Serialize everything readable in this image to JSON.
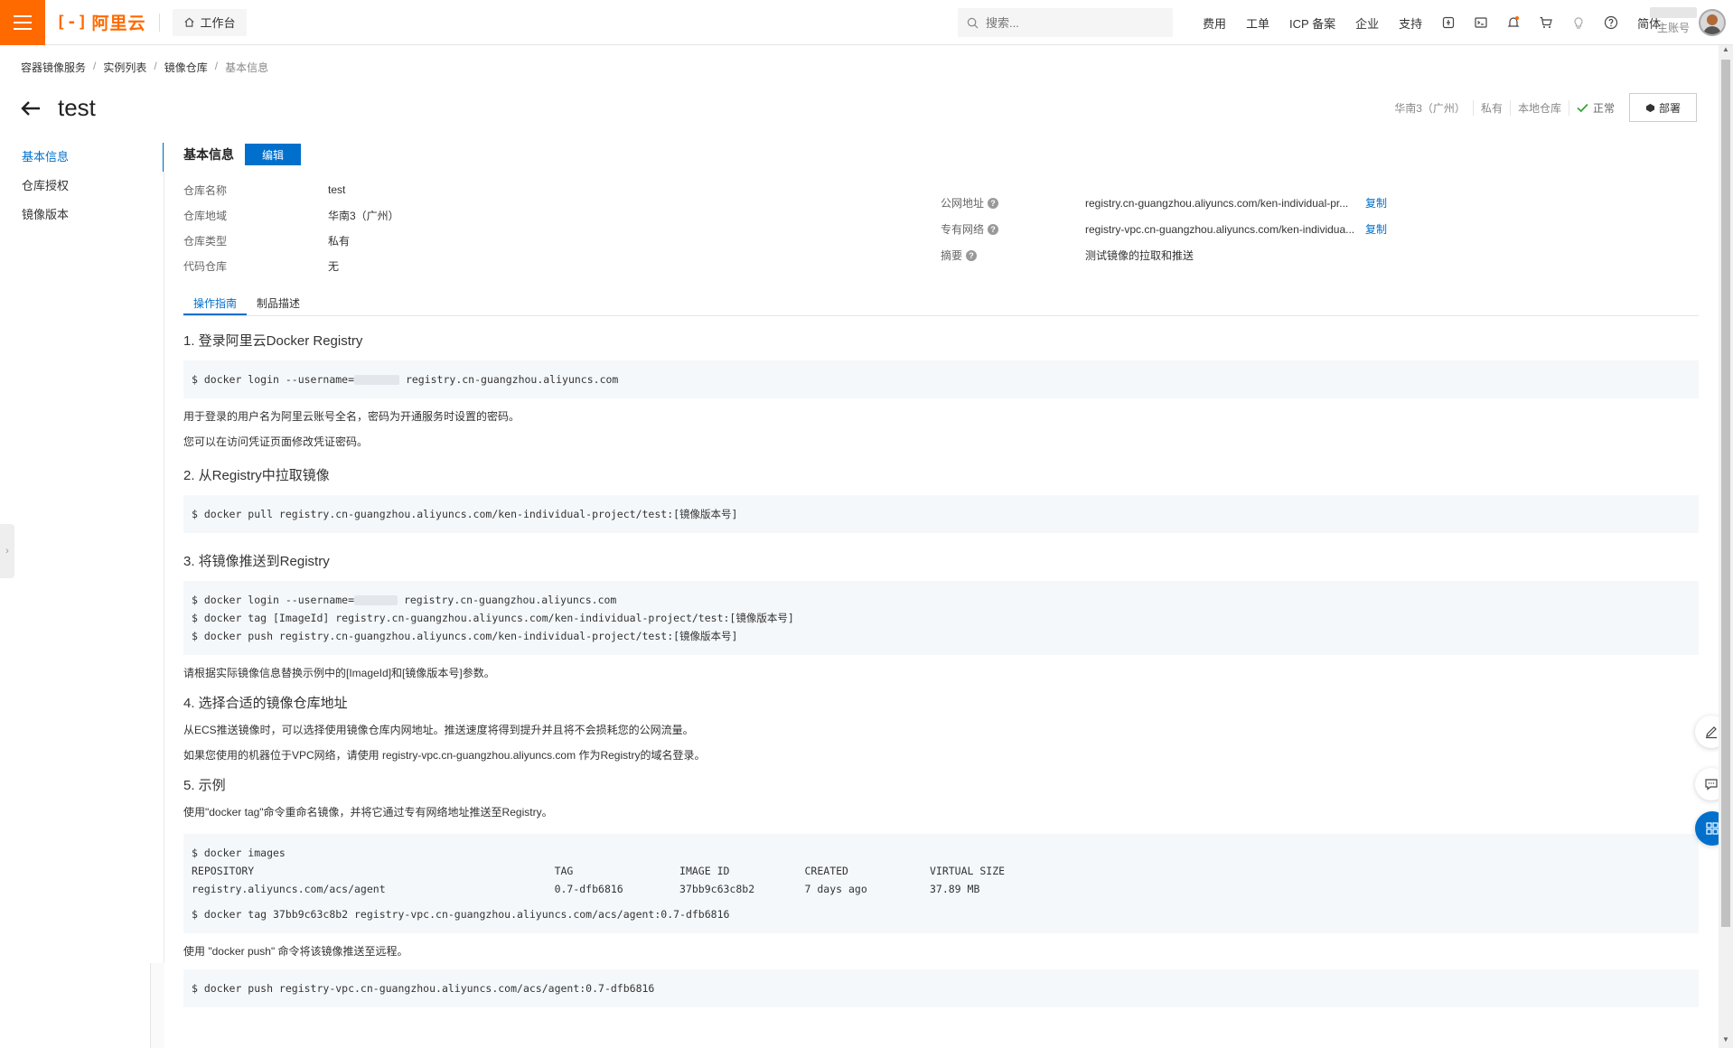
{
  "topbar": {
    "logo_text": "阿里云",
    "workbench": "工作台",
    "search_placeholder": "搜索...",
    "links": [
      "费用",
      "工单",
      "ICP 备案",
      "企业",
      "支持"
    ],
    "lang": "简体",
    "account_label": "主账号"
  },
  "breadcrumb": [
    "容器镜像服务",
    "实例列表",
    "镜像仓库",
    "基本信息"
  ],
  "page": {
    "title": "test",
    "region": "华南3（广州）",
    "type": "私有",
    "source": "本地仓库",
    "status": "正常",
    "deploy_label": "部署"
  },
  "sidenav": [
    "基本信息",
    "仓库授权",
    "镜像版本"
  ],
  "basic": {
    "heading": "基本信息",
    "edit_label": "编辑",
    "left": [
      {
        "k": "仓库名称",
        "v": "test"
      },
      {
        "k": "仓库地域",
        "v": "华南3（广州）"
      },
      {
        "k": "仓库类型",
        "v": "私有"
      },
      {
        "k": "代码仓库",
        "v": "无"
      }
    ],
    "right": [
      {
        "k": "公网地址",
        "v": "registry.cn-guangzhou.aliyuncs.com/ken-individual-pr...",
        "copy": "复制"
      },
      {
        "k": "专有网络",
        "v": "registry-vpc.cn-guangzhou.aliyuncs.com/ken-individua...",
        "copy": "复制"
      },
      {
        "k": "摘要",
        "v": "测试镜像的拉取和推送"
      }
    ]
  },
  "tabs": [
    "操作指南",
    "制品描述"
  ],
  "guide": {
    "s1_title": "1. 登录阿里云Docker Registry",
    "s1_code_a": "$ docker login --username=",
    "s1_code_b": " registry.cn-guangzhou.aliyuncs.com",
    "s1_p1": "用于登录的用户名为阿里云账号全名，密码为开通服务时设置的密码。",
    "s1_p2": "您可以在访问凭证页面修改凭证密码。",
    "s2_title": "2. 从Registry中拉取镜像",
    "s2_code": "$ docker pull registry.cn-guangzhou.aliyuncs.com/ken-individual-project/test:[镜像版本号]",
    "s3_title": "3. 将镜像推送到Registry",
    "s3_code_a": "$ docker login --username=",
    "s3_code_b": " registry.cn-guangzhou.aliyuncs.com",
    "s3_code_2": "$ docker tag [ImageId] registry.cn-guangzhou.aliyuncs.com/ken-individual-project/test:[镜像版本号]",
    "s3_code_3": "$ docker push registry.cn-guangzhou.aliyuncs.com/ken-individual-project/test:[镜像版本号]",
    "s3_p": "请根据实际镜像信息替换示例中的[ImageId]和[镜像版本号]参数。",
    "s4_title": "4. 选择合适的镜像仓库地址",
    "s4_p1": "从ECS推送镜像时，可以选择使用镜像仓库内网地址。推送速度将得到提升并且将不会损耗您的公网流量。",
    "s4_p2": "如果您使用的机器位于VPC网络，请使用 registry-vpc.cn-guangzhou.aliyuncs.com 作为Registry的域名登录。",
    "s5_title": "5. 示例",
    "s5_p1": "使用\"docker tag\"命令重命名镜像，并将它通过专有网络地址推送至Registry。",
    "s5_code_1": "$ docker images",
    "s5_code_2": "REPOSITORY                                                TAG                 IMAGE ID            CREATED             VIRTUAL SIZE",
    "s5_code_3": "registry.aliyuncs.com/acs/agent                           0.7-dfb6816         37bb9c63c8b2        7 days ago          37.89 MB",
    "s5_code_4": "$ docker tag 37bb9c63c8b2 registry-vpc.cn-guangzhou.aliyuncs.com/acs/agent:0.7-dfb6816",
    "s5_p2": "使用 \"docker push\" 命令将该镜像推送至远程。",
    "s5_code_5": "$ docker push registry-vpc.cn-guangzhou.aliyuncs.com/acs/agent:0.7-dfb6816"
  },
  "colors": {
    "brand": "#ff6a00",
    "primary": "#0070cc",
    "success": "#3aa53a"
  }
}
